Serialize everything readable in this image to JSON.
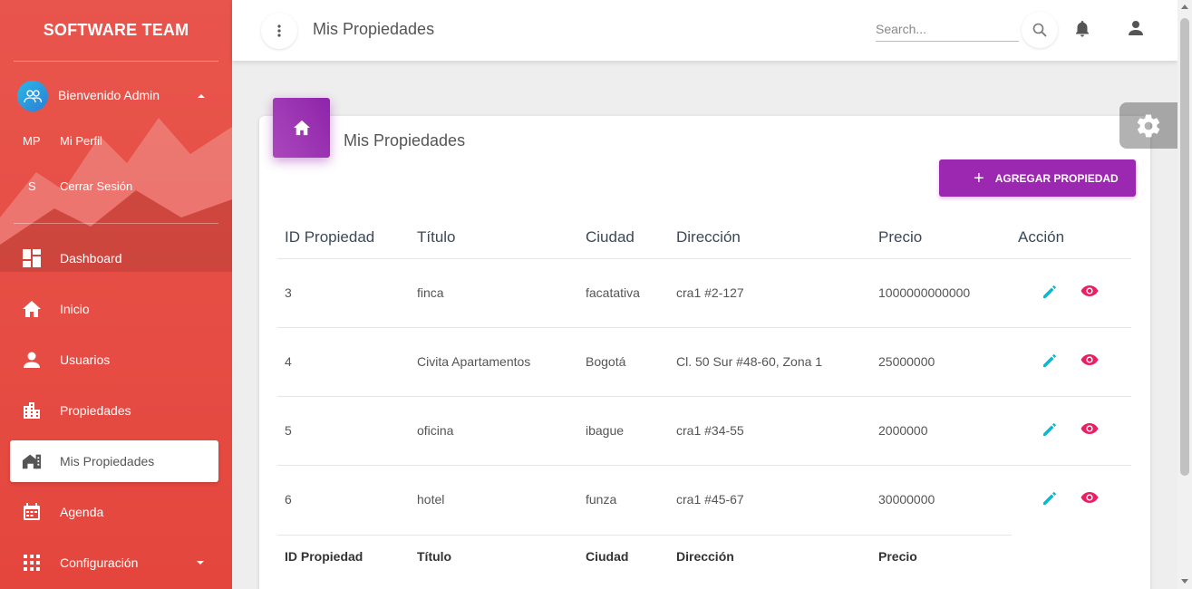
{
  "sidebar": {
    "brand": "SOFTWARE TEAM",
    "user": {
      "name": "Bienvenido Admin",
      "links": [
        {
          "abbr": "MP",
          "label": "Mi Perfil"
        },
        {
          "abbr": "S",
          "label": "Cerrar Sesión"
        }
      ]
    },
    "items": [
      {
        "label": "Dashboard",
        "icon": "dashboard-icon"
      },
      {
        "label": "Inicio",
        "icon": "home-icon"
      },
      {
        "label": "Usuarios",
        "icon": "person-icon"
      },
      {
        "label": "Propiedades",
        "icon": "building-icon"
      },
      {
        "label": "Mis Propiedades",
        "icon": "house-icon",
        "active": true
      },
      {
        "label": "Agenda",
        "icon": "calendar-icon"
      },
      {
        "label": "Configuración",
        "icon": "apps-icon"
      }
    ],
    "colors": {
      "background": "#e8554c",
      "active_bg": "#ffffff"
    }
  },
  "topbar": {
    "title": "Mis Propiedades",
    "search_placeholder": "Search..."
  },
  "card": {
    "title": "Mis Propiedades",
    "add_button": "AGREGAR PROPIEDAD",
    "accent": "#9c27b0"
  },
  "table": {
    "headers": [
      "ID Propiedad",
      "Título",
      "Ciudad",
      "Dirección",
      "Precio",
      "Acción"
    ],
    "rows": [
      {
        "id": "3",
        "titulo": "finca",
        "ciudad": "facatativa",
        "direccion": "cra1 #2-127",
        "precio": "1000000000000"
      },
      {
        "id": "4",
        "titulo": "Civita Apartamentos",
        "ciudad": "Bogotá",
        "direccion": "Cl. 50 Sur #48-60, Zona 1",
        "precio": "25000000"
      },
      {
        "id": "5",
        "titulo": "oficina",
        "ciudad": "ibague",
        "direccion": "cra1 #34-55",
        "precio": "2000000"
      },
      {
        "id": "6",
        "titulo": "hotel",
        "ciudad": "funza",
        "direccion": "cra1 #45-67",
        "precio": "30000000"
      }
    ],
    "footer": [
      "ID Propiedad",
      "Título",
      "Ciudad",
      "Dirección",
      "Precio"
    ],
    "colors": {
      "edit": "#00bcd4",
      "view": "#e91e63"
    }
  }
}
